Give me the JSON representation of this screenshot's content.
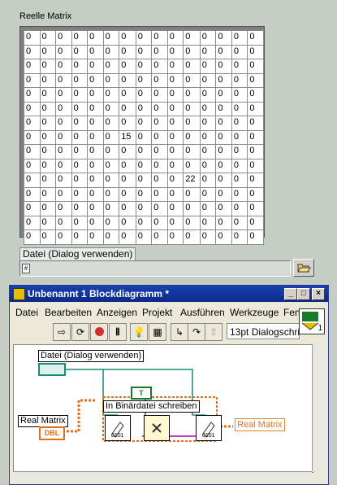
{
  "front_panel": {
    "matrix_label": "Reelle Matrix",
    "matrix_rows": [
      [
        "0",
        "0",
        "0",
        "0",
        "0",
        "0",
        "0",
        "0",
        "0",
        "0",
        "0",
        "0",
        "0",
        "0",
        "0"
      ],
      [
        "0",
        "0",
        "0",
        "0",
        "0",
        "0",
        "0",
        "0",
        "0",
        "0",
        "0",
        "0",
        "0",
        "0",
        "0"
      ],
      [
        "0",
        "0",
        "0",
        "0",
        "0",
        "0",
        "0",
        "0",
        "0",
        "0",
        "0",
        "0",
        "0",
        "0",
        "0"
      ],
      [
        "0",
        "0",
        "0",
        "0",
        "0",
        "0",
        "0",
        "0",
        "0",
        "0",
        "0",
        "0",
        "0",
        "0",
        "0"
      ],
      [
        "0",
        "0",
        "0",
        "0",
        "0",
        "0",
        "0",
        "0",
        "0",
        "0",
        "0",
        "0",
        "0",
        "0",
        "0"
      ],
      [
        "0",
        "0",
        "0",
        "0",
        "0",
        "0",
        "0",
        "0",
        "0",
        "0",
        "0",
        "0",
        "0",
        "0",
        "0"
      ],
      [
        "0",
        "0",
        "0",
        "0",
        "0",
        "0",
        "0",
        "0",
        "0",
        "0",
        "0",
        "0",
        "0",
        "0",
        "0"
      ],
      [
        "0",
        "0",
        "0",
        "0",
        "0",
        "0",
        "15",
        "0",
        "0",
        "0",
        "0",
        "0",
        "0",
        "0",
        "0"
      ],
      [
        "0",
        "0",
        "0",
        "0",
        "0",
        "0",
        "0",
        "0",
        "0",
        "0",
        "0",
        "0",
        "0",
        "0",
        "0"
      ],
      [
        "0",
        "0",
        "0",
        "0",
        "0",
        "0",
        "0",
        "0",
        "0",
        "0",
        "0",
        "0",
        "0",
        "0",
        "0"
      ],
      [
        "0",
        "0",
        "0",
        "0",
        "0",
        "0",
        "0",
        "0",
        "0",
        "0",
        "22",
        "0",
        "0",
        "0",
        "0"
      ],
      [
        "0",
        "0",
        "0",
        "0",
        "0",
        "0",
        "0",
        "0",
        "0",
        "0",
        "0",
        "0",
        "0",
        "0",
        "0"
      ],
      [
        "0",
        "0",
        "0",
        "0",
        "0",
        "0",
        "0",
        "0",
        "0",
        "0",
        "0",
        "0",
        "0",
        "0",
        "0"
      ],
      [
        "0",
        "0",
        "0",
        "0",
        "0",
        "0",
        "0",
        "0",
        "0",
        "0",
        "0",
        "0",
        "0",
        "0",
        "0"
      ],
      [
        "0",
        "0",
        "0",
        "0",
        "0",
        "0",
        "0",
        "0",
        "0",
        "0",
        "0",
        "0",
        "0",
        "0",
        "0"
      ]
    ],
    "file_label": "Datei (Dialog verwenden)",
    "path_value": "",
    "browse_icon": "folder-open-icon"
  },
  "block_window": {
    "title": "Unbenannt 1 Blockdiagramm *",
    "menu": [
      "Datei",
      "Bearbeiten",
      "Anzeigen",
      "Projekt",
      "Ausführen",
      "Werkzeuge",
      "Fen"
    ],
    "font_selector": "13pt Dialogschrift",
    "vi_icon_number": "1"
  },
  "diagram": {
    "file_control_label": "Datei (Dialog verwenden)",
    "real_matrix_control_label": "Real Matrix",
    "dbl_terminal": "DBL",
    "bool_constant": "T",
    "function_label": "In Binärdatei schreiben",
    "real_matrix_indicator": "Real Matrix",
    "node_text": "0101"
  }
}
